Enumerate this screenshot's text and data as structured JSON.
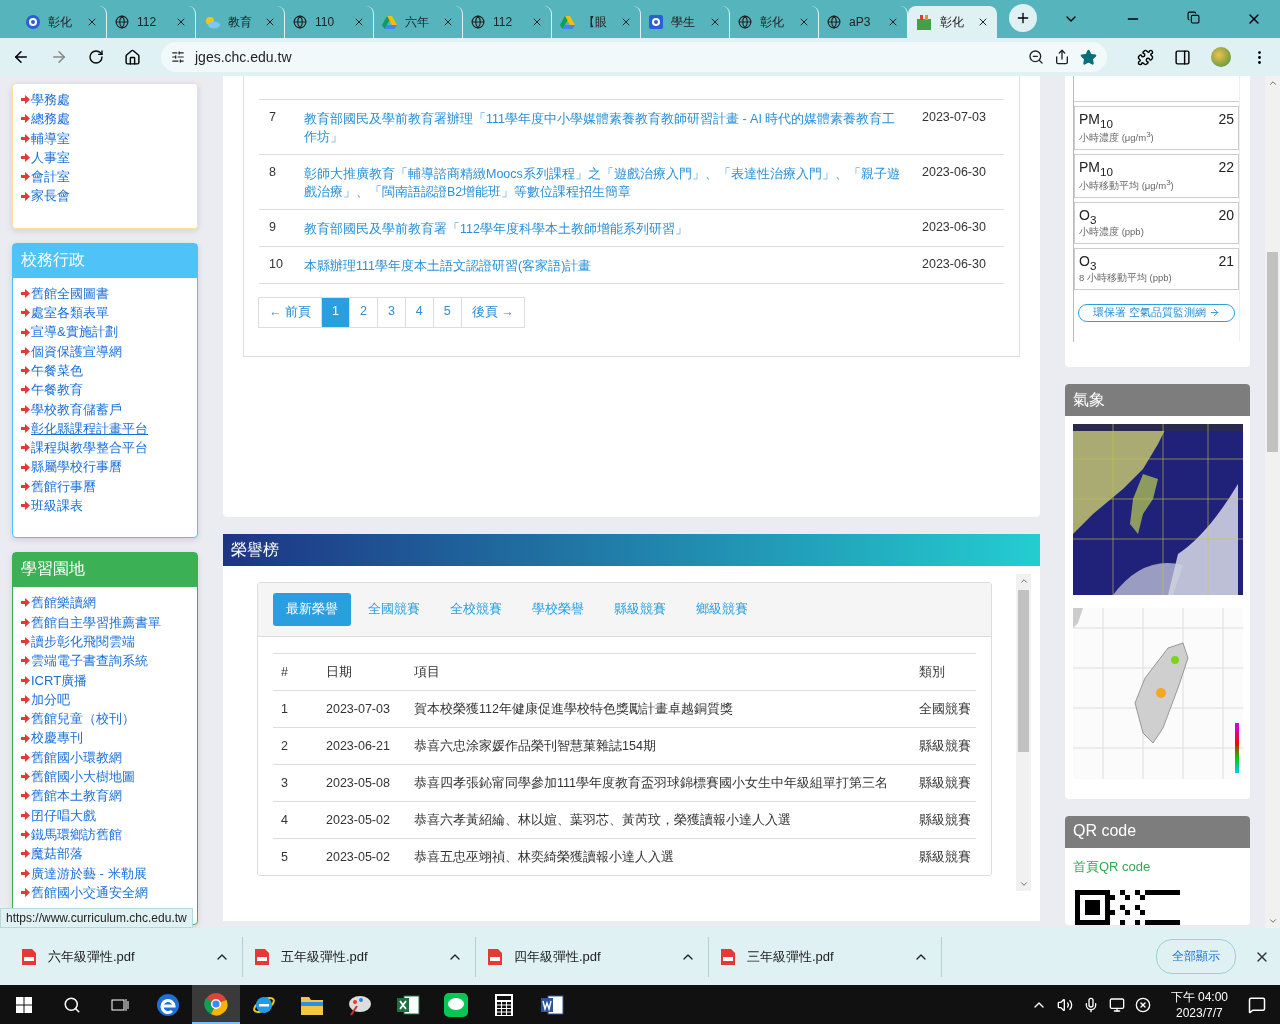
{
  "browser": {
    "tabs": [
      {
        "title": "彰化",
        "kind": "ring",
        "selected": false
      },
      {
        "title": "112",
        "kind": "globe",
        "selected": false
      },
      {
        "title": "教育",
        "kind": "weather",
        "selected": false
      },
      {
        "title": "110",
        "kind": "globe",
        "selected": false
      },
      {
        "title": "六年",
        "kind": "drive",
        "selected": false
      },
      {
        "title": "112",
        "kind": "globe",
        "selected": false
      },
      {
        "title": "【眼",
        "kind": "drive",
        "selected": false
      },
      {
        "title": "學生",
        "kind": "square",
        "selected": false
      },
      {
        "title": "彰化",
        "kind": "globe",
        "selected": false
      },
      {
        "title": "aP3",
        "kind": "globe",
        "selected": false
      },
      {
        "title": "彰化",
        "kind": "shop",
        "selected": true
      }
    ],
    "url": "jges.chc.edu.tw"
  },
  "sidebar": {
    "sections": [
      {
        "color": "#fbe3a0",
        "items": [
          {
            "label": "學務處",
            "hovered": false
          },
          {
            "label": "總務處",
            "hovered": false
          },
          {
            "label": "輔導室",
            "hovered": false
          },
          {
            "label": "人事室",
            "hovered": false
          },
          {
            "label": "會計室",
            "hovered": false
          },
          {
            "label": "家長會",
            "hovered": false
          }
        ]
      },
      {
        "title": "校務行政",
        "color": "#4fc3f7",
        "items": [
          {
            "label": "舊館全國圖書",
            "hovered": false
          },
          {
            "label": "處室各類表單",
            "hovered": false
          },
          {
            "label": "宣導&實施計劃",
            "hovered": false
          },
          {
            "label": "個資保護宣導網",
            "hovered": false
          },
          {
            "label": "午餐菜色",
            "hovered": false
          },
          {
            "label": "午餐教育",
            "hovered": false
          },
          {
            "label": "學校教育儲蓄戶",
            "hovered": false
          },
          {
            "label": "彰化縣課程計畫平台",
            "hovered": true
          },
          {
            "label": "課程與教學整合平台",
            "hovered": false
          },
          {
            "label": "縣屬學校行事曆",
            "hovered": false
          },
          {
            "label": "舊館行事曆",
            "hovered": false
          },
          {
            "label": "班級課表",
            "hovered": false
          }
        ]
      },
      {
        "title": "學習園地",
        "color": "#3cb054",
        "items": [
          {
            "label": "舊館樂讀網",
            "hovered": false
          },
          {
            "label": "舊館自主學習推薦書單",
            "hovered": false
          },
          {
            "label": "讀步彰化飛閱雲端",
            "hovered": false
          },
          {
            "label": "雲端電子書查詢系統",
            "hovered": false
          },
          {
            "label": "ICRT廣播",
            "hovered": false
          },
          {
            "label": "加分吧",
            "hovered": false
          },
          {
            "label": "舊館兒童（校刊）",
            "hovered": false
          },
          {
            "label": "校慶專刊",
            "hovered": false
          },
          {
            "label": "舊館國小環教網",
            "hovered": false
          },
          {
            "label": "舊館國小大樹地圖",
            "hovered": false
          },
          {
            "label": "舊館本土教育網",
            "hovered": false
          },
          {
            "label": "囝仔唱大戲",
            "hovered": false
          },
          {
            "label": "鐵馬環鄉訪舊館",
            "hovered": false
          },
          {
            "label": "魔菇部落",
            "hovered": false
          },
          {
            "label": "廣達游於藝 - 米勒展",
            "hovered": false
          },
          {
            "label": "舊館國小交通安全網",
            "hovered": false
          }
        ]
      }
    ]
  },
  "news": {
    "rows": [
      {
        "num": "7",
        "title": "教育部國民及學前教育署辦理「111學年度中小學媒體素養教育教師研習計畫 - AI 時代的媒體素養教育工作坊」",
        "date": "2023-07-03"
      },
      {
        "num": "8",
        "title": "彰師大推廣教育「輔導諮商精緻Moocs系列課程」之「遊戲治療入門」、「表達性治療入門」、「親子遊戲治療」、「閩南語認證B2增能班」等數位課程招生簡章",
        "date": "2023-06-30"
      },
      {
        "num": "9",
        "title": "教育部國民及學前教育署「112學年度科學本土教師增能系列研習」",
        "date": "2023-06-30"
      },
      {
        "num": "10",
        "title": "本縣辦理111學年度本土語文認證研習(客家語)計畫",
        "date": "2023-06-30"
      }
    ],
    "pagination": {
      "prev": "← 前頁",
      "pages": [
        {
          "label": "1",
          "selected": true
        },
        {
          "label": "2",
          "selected": false
        },
        {
          "label": "3",
          "selected": false
        },
        {
          "label": "4",
          "selected": false
        },
        {
          "label": "5",
          "selected": false
        }
      ],
      "next": "後頁 →"
    }
  },
  "honors": {
    "title": "榮譽榜",
    "tabs": [
      {
        "label": "最新榮譽",
        "selected": true
      },
      {
        "label": "全國競賽",
        "selected": false
      },
      {
        "label": "全校競賽",
        "selected": false
      },
      {
        "label": "學校榮譽",
        "selected": false
      },
      {
        "label": "縣級競賽",
        "selected": false
      },
      {
        "label": "鄉級競賽",
        "selected": false
      }
    ],
    "columns": [
      "#",
      "日期",
      "項目",
      "類別"
    ],
    "rows": [
      [
        "1",
        "2023-07-03",
        "賀本校榮獲112年健康促進學校特色獎勵計畫卓越銅質獎",
        "全國競賽"
      ],
      [
        "2",
        "2023-06-21",
        "恭喜六忠涂家媛作品榮刊智慧菓雜誌154期",
        "縣級競賽"
      ],
      [
        "3",
        "2023-05-08",
        "恭喜四孝張鈊甯同學參加111學年度教育盃羽球錦標賽國小女生中年級組單打第三名",
        "縣級競賽"
      ],
      [
        "4",
        "2023-05-02",
        "恭喜六孝黃紹綸、林以媗、葉羽芯、黃芮玟，榮獲讀報小達人入選",
        "縣級競賽"
      ],
      [
        "5",
        "2023-05-02",
        "恭喜五忠巫翊禎、林奕綺榮獲讀報小達人入選",
        "縣級競賽"
      ]
    ]
  },
  "air_quality": {
    "items": [
      {
        "name": "PM$_{10}$",
        "value": "25",
        "unit": "小時濃度 (μg/m$^{3}$)"
      },
      {
        "name": "PM$_{10}$",
        "value": "22",
        "unit": "小時移動平均 (μg/m$^{3}$)"
      },
      {
        "name": "O$_{3}$",
        "value": "20",
        "unit": "小時濃度 (ppb)"
      },
      {
        "name": "O$_{3}$",
        "value": "21",
        "unit": "8 小時移動平均 (ppb)"
      }
    ],
    "link": "環保署 空氣品質監測網"
  },
  "weather": {
    "title": "氣象"
  },
  "qr": {
    "title": "QR code",
    "link": "首頁QR code"
  },
  "status_url": "https://www.curriculum.chc.edu.tw",
  "downloads": {
    "files": [
      "六年級彈性.pdf",
      "五年級彈性.pdf",
      "四年級彈性.pdf",
      "三年級彈性.pdf"
    ],
    "show_all": "全部顯示"
  },
  "taskbar": {
    "apps": [
      {
        "kind": "edge",
        "selected": false
      },
      {
        "kind": "chrome",
        "selected": true
      },
      {
        "kind": "ie",
        "selected": false
      },
      {
        "kind": "folder",
        "selected": false
      },
      {
        "kind": "paint",
        "selected": false
      },
      {
        "kind": "excel",
        "selected": false
      },
      {
        "kind": "line",
        "selected": false
      },
      {
        "kind": "calc",
        "selected": false
      },
      {
        "kind": "word",
        "selected": false
      }
    ],
    "time": "下午 04:00",
    "date": "2023/7/7"
  }
}
